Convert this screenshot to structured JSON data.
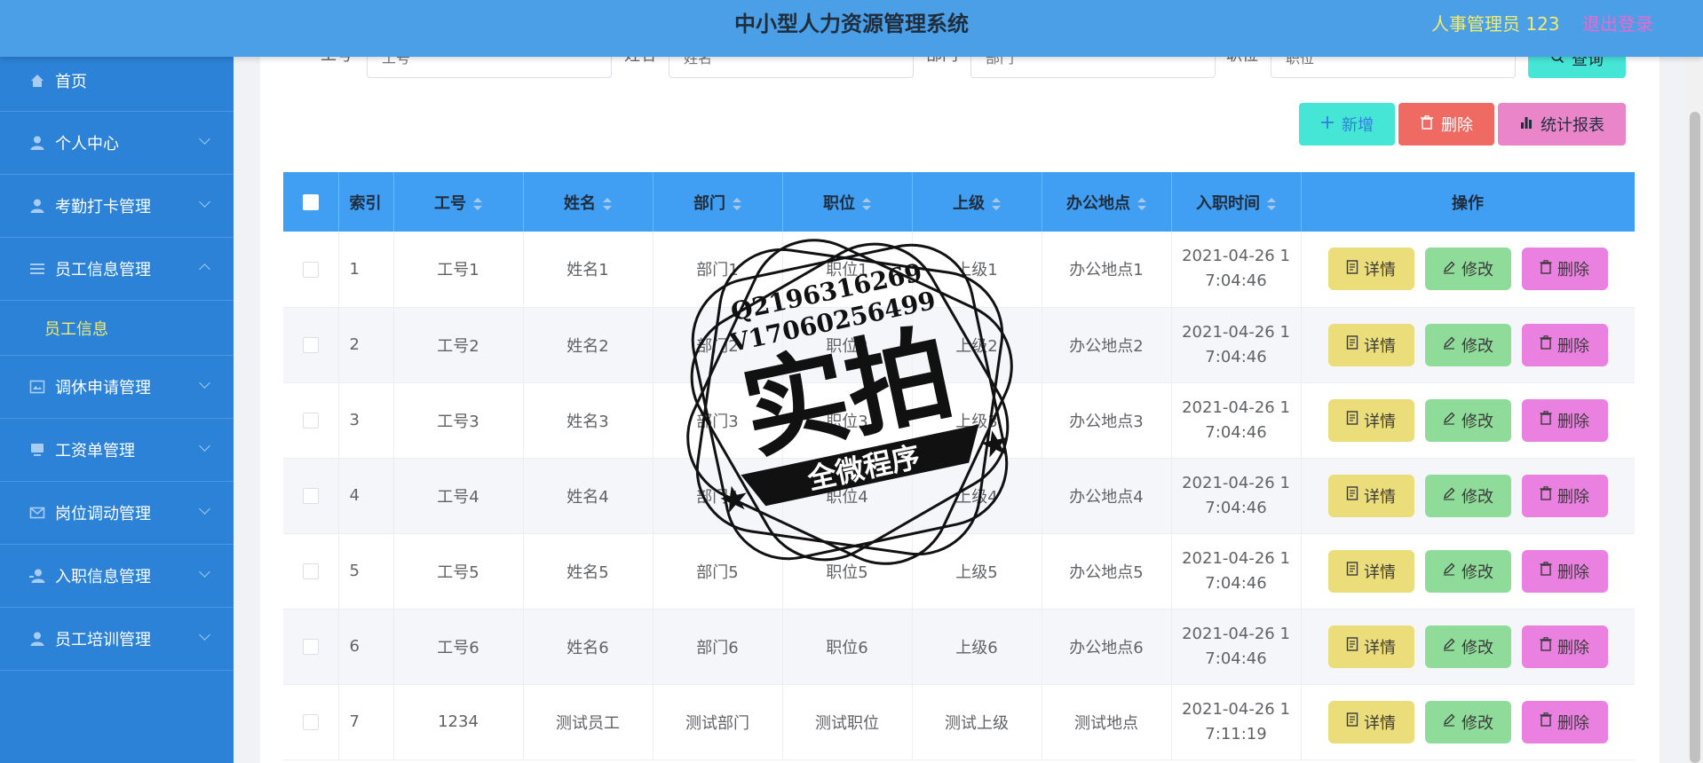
{
  "header": {
    "title": "中小型人力资源管理系统",
    "user": "人事管理员 123",
    "logout": "退出登录"
  },
  "sidebar": {
    "items": [
      {
        "label": "首页",
        "icon": "home-icon"
      },
      {
        "label": "个人中心",
        "icon": "user-icon"
      },
      {
        "label": "考勤打卡管理",
        "icon": "user-icon"
      },
      {
        "label": "员工信息管理",
        "icon": "list-icon"
      },
      {
        "label": "调休申请管理",
        "icon": "image-icon"
      },
      {
        "label": "工资单管理",
        "icon": "monitor-icon"
      },
      {
        "label": "岗位调动管理",
        "icon": "mail-icon"
      },
      {
        "label": "入职信息管理",
        "icon": "user-icon"
      },
      {
        "label": "员工培训管理",
        "icon": "user-icon"
      }
    ],
    "submenu": "员工信息"
  },
  "search": {
    "fields": [
      {
        "label": "工号",
        "placeholder": "工号"
      },
      {
        "label": "姓名",
        "placeholder": "姓名"
      },
      {
        "label": "部门",
        "placeholder": "部门"
      },
      {
        "label": "职位",
        "placeholder": "职位"
      }
    ],
    "query_label": "查询"
  },
  "actions": {
    "add": "新增",
    "delete": "删除",
    "stats": "统计报表"
  },
  "table": {
    "columns": [
      "索引",
      "工号",
      "姓名",
      "部门",
      "职位",
      "上级",
      "办公地点",
      "入职时间",
      "操作"
    ],
    "op_labels": {
      "detail": "详情",
      "edit": "修改",
      "delete": "删除"
    },
    "rows": [
      {
        "idx": "1",
        "no": "工号1",
        "name": "姓名1",
        "dept": "部门1",
        "pos": "职位1",
        "sup": "上级1",
        "office": "办公地点1",
        "t1": "2021-04-26 1",
        "t2": "7:04:46"
      },
      {
        "idx": "2",
        "no": "工号2",
        "name": "姓名2",
        "dept": "部门2",
        "pos": "职位2",
        "sup": "上级2",
        "office": "办公地点2",
        "t1": "2021-04-26 1",
        "t2": "7:04:46"
      },
      {
        "idx": "3",
        "no": "工号3",
        "name": "姓名3",
        "dept": "部门3",
        "pos": "职位3",
        "sup": "上级3",
        "office": "办公地点3",
        "t1": "2021-04-26 1",
        "t2": "7:04:46"
      },
      {
        "idx": "4",
        "no": "工号4",
        "name": "姓名4",
        "dept": "部门4",
        "pos": "职位4",
        "sup": "上级4",
        "office": "办公地点4",
        "t1": "2021-04-26 1",
        "t2": "7:04:46"
      },
      {
        "idx": "5",
        "no": "工号5",
        "name": "姓名5",
        "dept": "部门5",
        "pos": "职位5",
        "sup": "上级5",
        "office": "办公地点5",
        "t1": "2021-04-26 1",
        "t2": "7:04:46"
      },
      {
        "idx": "6",
        "no": "工号6",
        "name": "姓名6",
        "dept": "部门6",
        "pos": "职位6",
        "sup": "上级6",
        "office": "办公地点6",
        "t1": "2021-04-26 1",
        "t2": "7:04:46"
      },
      {
        "idx": "7",
        "no": "1234",
        "name": "测试员工",
        "dept": "测试部门",
        "pos": "测试职位",
        "sup": "测试上级",
        "office": "测试地点",
        "t1": "2021-04-26 1",
        "t2": "7:11:19"
      }
    ]
  },
  "watermark": {
    "line1": "Q2196316269",
    "line2": "V17060256499",
    "main": "实拍",
    "ribbon": "全微程序"
  },
  "colors": {
    "header_bg": "#4a9fe6",
    "sidebar_bg": "#2c82d6",
    "accent_yellow": "#f3ec6f",
    "table_header": "#409ef3"
  }
}
